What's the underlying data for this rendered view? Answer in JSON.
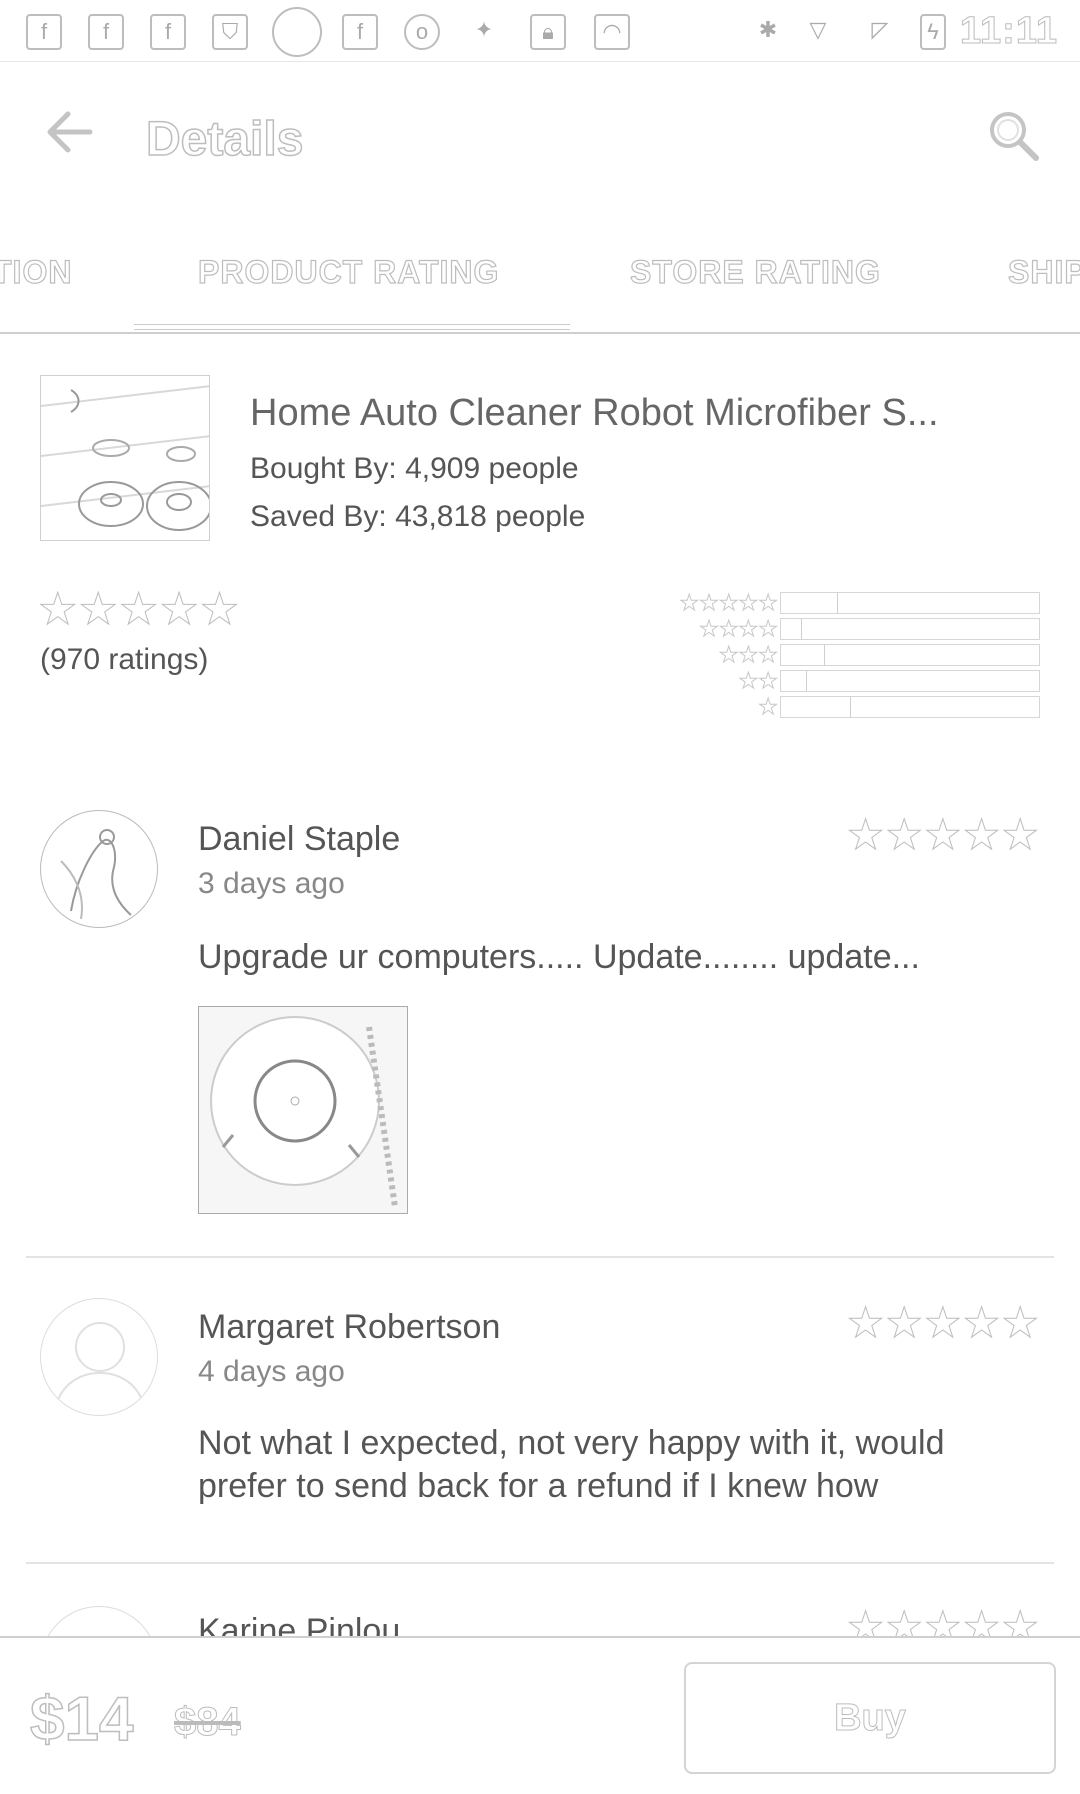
{
  "status_bar": {
    "time": "11:11"
  },
  "app_bar": {
    "title": "Details"
  },
  "tabs": [
    {
      "label": "TION"
    },
    {
      "label": "PRODUCT RATING"
    },
    {
      "label": "STORE RATING"
    },
    {
      "label": "SHIP"
    }
  ],
  "product": {
    "name": "Home Auto Cleaner Robot Microfiber S...",
    "bought_by": "Bought By: 4,909 people",
    "saved_by": "Saved By: 43,818 people"
  },
  "rating_summary": {
    "stars": "★★★★★",
    "ratings_count": "(970 ratings)",
    "histogram": [
      {
        "stars": "★★★★★",
        "fraction": 0.22
      },
      {
        "stars": "★★★★",
        "fraction": 0.08
      },
      {
        "stars": "★★★",
        "fraction": 0.17
      },
      {
        "stars": "★★",
        "fraction": 0.1
      },
      {
        "stars": "★",
        "fraction": 0.27
      }
    ]
  },
  "reviews": [
    {
      "name": "Daniel Staple",
      "date": "3 days ago",
      "stars": "★★★★★",
      "text": "Upgrade ur computers..... Update........ update..."
    },
    {
      "name": "Margaret Robertson",
      "date": "4 days ago",
      "stars": "★★★★★",
      "text": "Not what I expected, not very happy with it, would prefer to send back for a refund if I knew how"
    },
    {
      "name": "Karine Pinlou",
      "stars": "★★★★★"
    }
  ],
  "bottom_bar": {
    "price": "$14",
    "old_price": "$84",
    "buy_label": "Buy"
  }
}
